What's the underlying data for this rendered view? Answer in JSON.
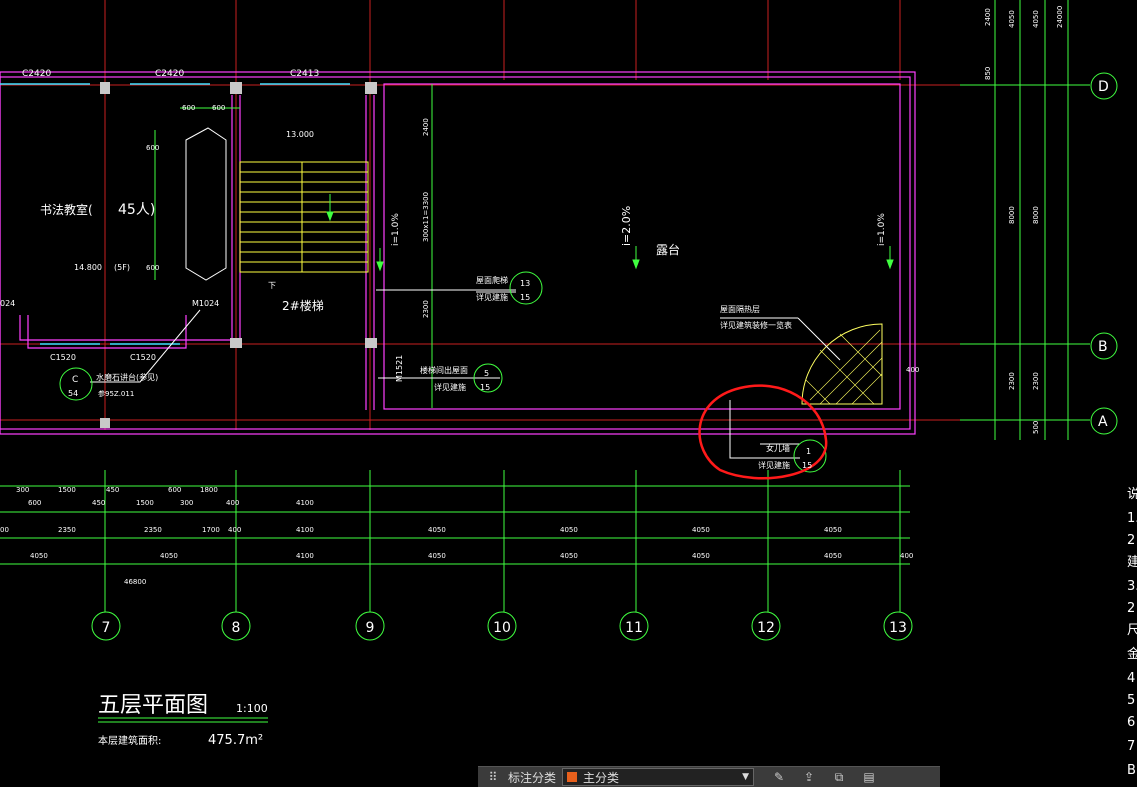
{
  "drawing": {
    "window_labels_top": [
      "C2420",
      "C2420",
      "C2413"
    ],
    "room_name": "书法教室(",
    "room_capacity": "45人)",
    "room_dims": [
      "600",
      "600",
      "600",
      "600"
    ],
    "level_label": "14.800",
    "level_note": "(5F)",
    "door_label": "M1024",
    "window_labels_bottom": [
      "C1520",
      "C1520"
    ],
    "window_left_edge": "024",
    "detail_c": {
      "letter": "C",
      "sheet": "54",
      "text": "水磨石讲台(参见)",
      "ref": "参95Z.011"
    },
    "stair_level": "13.000",
    "stair_down": "下",
    "stair_name": "2#楼梯",
    "slope_left": "i=1.0%",
    "slope_mid": "i=2.0%",
    "slope_right": "i=1.0%",
    "terrace": "露台",
    "dim_vertical_mid": [
      "2400",
      "300x11=3300",
      "2300"
    ],
    "callout_drain": {
      "line1": "屋面爬梯",
      "line2": "详见建施",
      "num": "13",
      "sheet": "15"
    },
    "callout_stair_exit": {
      "line1": "楼梯间出屋面",
      "line2": "详见建施",
      "num": "5",
      "sheet": "15"
    },
    "door_m": "M1521",
    "roof_note": [
      "屋面隔热层",
      "详见建筑装修一览表"
    ],
    "parapet": {
      "line1": "女儿墙",
      "line2": "详见建施",
      "num": "1",
      "sheet": "15"
    },
    "dim_right_small": "400",
    "right_dims_col1": [
      "2400",
      "850",
      "8000",
      "2300",
      "500"
    ],
    "right_dims_col2": [
      "4050",
      "8000",
      "2300"
    ],
    "right_dims_col3": [
      "4050",
      "8000"
    ],
    "right_dims_col4": [
      "24000"
    ],
    "grid_rows": [
      "D",
      "B",
      "A"
    ],
    "dim_row1": [
      "300",
      "600",
      "1500",
      "450",
      "450",
      "1500",
      "600",
      "300",
      "1800",
      "400",
      "4100"
    ],
    "dim_row2": [
      "00",
      "2350",
      "2350",
      "1700",
      "400",
      "4100",
      "4050",
      "4050",
      "4050",
      "4050"
    ],
    "dim_row3": [
      "4050",
      "4050",
      "4100",
      "4050",
      "4050",
      "4050",
      "4050",
      "400"
    ],
    "dim_total": "46800",
    "grid_cols": [
      "7",
      "8",
      "9",
      "10",
      "11",
      "12",
      "13"
    ],
    "title": "五层平面图",
    "scale": "1:100",
    "area_label": "本层建筑面积:",
    "area_value": "475.7m²",
    "right_edge_chars": [
      "说",
      "1.",
      "2",
      "建",
      "3.",
      "2",
      "尺",
      "金",
      "4",
      "5",
      "6",
      "7",
      "B"
    ]
  },
  "toolbar": {
    "label": "标注分类",
    "select_value": "主分类"
  },
  "colors": {
    "grid": "#ff3030",
    "wall": "#ff40ff",
    "dim": "#40ff40",
    "stair": "#ffff40",
    "text": "#ffffff",
    "annotation": "#ff0000"
  }
}
